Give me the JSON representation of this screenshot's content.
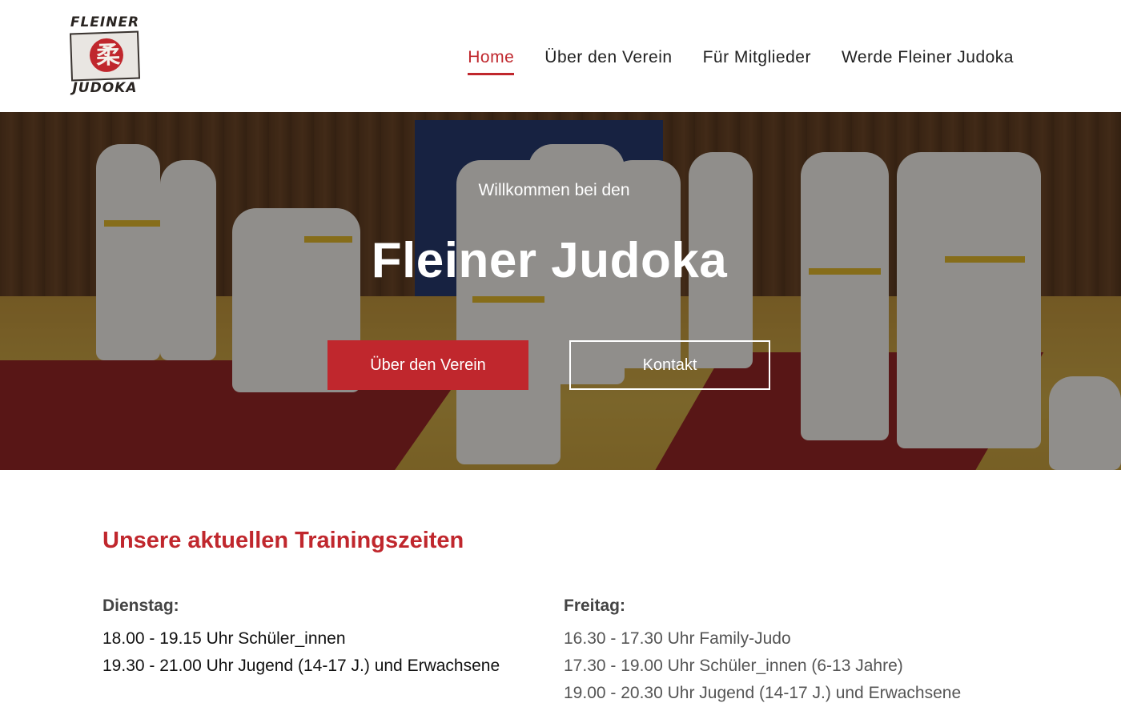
{
  "logo": {
    "top_text": "FLEINER",
    "bottom_text": "JUDOKA",
    "glyph": "柔"
  },
  "nav": {
    "items": [
      {
        "label": "Home",
        "active": true
      },
      {
        "label": "Über den Verein",
        "active": false
      },
      {
        "label": "Für Mitglieder",
        "active": false
      },
      {
        "label": "Werde Fleiner Judoka",
        "active": false
      }
    ]
  },
  "hero": {
    "subtitle": "Willkommen bei den",
    "title": "Fleiner Judoka",
    "primary_button": "Über den Verein",
    "secondary_button": "Kontakt"
  },
  "training": {
    "heading": "Unsere aktuellen Trainingszeiten",
    "days": [
      {
        "day": "Dienstag:",
        "lines": [
          "18.00 - 19.15 Uhr Schüler_innen",
          "19.30 - 21.00 Uhr Jugend (14-17 J.) und Erwachsene"
        ]
      },
      {
        "day": "Freitag:",
        "lines": [
          "16.30 - 17.30 Uhr Family-Judo",
          "17.30 - 19.00 Uhr Schüler_innen (6-13 Jahre)",
          "19.00 - 20.30 Uhr Jugend (14-17 J.) und Erwachsene"
        ]
      }
    ]
  },
  "colors": {
    "accent": "#c0272d",
    "text": "#222222"
  }
}
